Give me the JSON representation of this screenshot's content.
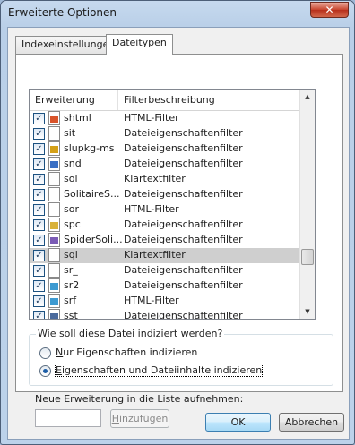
{
  "window": {
    "title": "Erweiterte Optionen",
    "close_glyph": "✕"
  },
  "tabs": [
    {
      "label": "Indexeinstellungen",
      "active": false
    },
    {
      "label": "Dateitypen",
      "active": true
    }
  ],
  "list": {
    "columns": [
      "Erweiterung",
      "Filterbeschreibung"
    ],
    "rows": [
      {
        "ext": "shtml",
        "desc": "HTML-Filter",
        "checked": true,
        "icon": "web-page-icon"
      },
      {
        "ext": "sit",
        "desc": "Dateieigenschaftenfilter",
        "checked": true,
        "icon": "blank-file-icon"
      },
      {
        "ext": "slupkg-ms",
        "desc": "Dateieigenschaftenfilter",
        "checked": true,
        "icon": "package-key-icon"
      },
      {
        "ext": "snd",
        "desc": "Dateieigenschaftenfilter",
        "checked": true,
        "icon": "audio-file-icon"
      },
      {
        "ext": "sol",
        "desc": "Klartextfilter",
        "checked": true,
        "icon": "blank-file-icon"
      },
      {
        "ext": "SolitaireS...",
        "desc": "Dateieigenschaftenfilter",
        "checked": true,
        "icon": "blank-file-icon"
      },
      {
        "ext": "sor",
        "desc": "HTML-Filter",
        "checked": true,
        "icon": "blank-file-icon"
      },
      {
        "ext": "spc",
        "desc": "Dateieigenschaftenfilter",
        "checked": true,
        "icon": "certificate-icon"
      },
      {
        "ext": "SpiderSoli...",
        "desc": "Dateieigenschaftenfilter",
        "checked": true,
        "icon": "game-file-icon"
      },
      {
        "ext": "sql",
        "desc": "Klartextfilter",
        "checked": true,
        "icon": "blank-file-icon",
        "selected": true
      },
      {
        "ext": "sr_",
        "desc": "Dateieigenschaftenfilter",
        "checked": true,
        "icon": "blank-file-icon"
      },
      {
        "ext": "sr2",
        "desc": "Dateieigenschaftenfilter",
        "checked": true,
        "icon": "image-file-icon"
      },
      {
        "ext": "srf",
        "desc": "HTML-Filter",
        "checked": true,
        "icon": "image-file-icon"
      },
      {
        "ext": "sst",
        "desc": "Dateieigenschaftenfilter",
        "checked": true,
        "icon": "certificate-file-icon"
      }
    ],
    "scroll_up": "▲",
    "scroll_down": "▼"
  },
  "index_group": {
    "legend": "Wie soll diese Datei indiziert werden?",
    "options": [
      {
        "label": "Nur Eigenschaften indizieren",
        "selected": false
      },
      {
        "label": "Eigenschaften und Dateiinhalte indizieren",
        "selected": true
      }
    ]
  },
  "new_extension": {
    "label": "Neue Erweiterung in die Liste aufnehmen:",
    "value": "",
    "add_button": "Hinzufügen"
  },
  "footer": {
    "ok": "OK",
    "cancel": "Abbrechen"
  }
}
